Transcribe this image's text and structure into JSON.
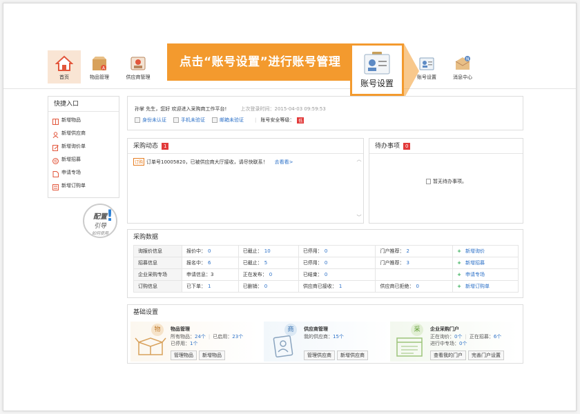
{
  "callout": {
    "text": "点击“账号设置”进行账号管理",
    "box_label": "账号设置",
    "accent": "#f39a2e"
  },
  "nav": {
    "items": [
      {
        "label": "首页",
        "icon": "home-icon",
        "active": true
      },
      {
        "label": "物品管理",
        "icon": "box-icon"
      },
      {
        "label": "供应商管理",
        "icon": "supplier-icon"
      },
      {
        "label": "账号设置",
        "icon": "id-card-icon"
      },
      {
        "label": "消息中心",
        "icon": "message-icon"
      }
    ]
  },
  "sidebar": {
    "title": "快捷入口",
    "items": [
      {
        "label": "新增物品",
        "icon": "grid-icon"
      },
      {
        "label": "新增供应商",
        "icon": "user-icon"
      },
      {
        "label": "新增询价单",
        "icon": "edit-icon"
      },
      {
        "label": "新增招募",
        "icon": "recruit-icon"
      },
      {
        "label": "申请专场",
        "icon": "doc-icon"
      },
      {
        "label": "新增订购单",
        "icon": "order-icon"
      }
    ]
  },
  "guide_badge": {
    "line1": "配置",
    "line2": "引导",
    "line3": "如何使用",
    "mark": "!"
  },
  "welcome": {
    "greeting": "孙掌 先生，您好 欢迎进入采购商工作平台!",
    "last_login_label": "上次登录时间：",
    "last_login": "2015-04-03 09:59:53",
    "verify": [
      "身份未认证",
      "手机未验证",
      "邮箱未验证"
    ],
    "security_label": "账号安全等级：",
    "security_level": "低"
  },
  "activity": {
    "title": "采购动态",
    "count": "1",
    "tag": "订购",
    "message": "订单号10005820，已被供应商大厅接收，请尽快联系！",
    "link": "去看看>"
  },
  "todo": {
    "title": "待办事项",
    "count": "0",
    "empty": "暂无待办事项。"
  },
  "pdata": {
    "title": "采购数据",
    "rows": [
      {
        "cat": "询报价信息",
        "c1l": "报价中：",
        "c1v": "0",
        "c2l": "已截止：",
        "c2v": "10",
        "c3l": "已停用：",
        "c3v": "0",
        "c4l": "门户推荐：",
        "c4v": "2",
        "action": "新增询价"
      },
      {
        "cat": "招募信息",
        "c1l": "报名中：",
        "c1v": "6",
        "c2l": "已截止：",
        "c2v": "5",
        "c3l": "已停用：",
        "c3v": "0",
        "c4l": "门户推荐：",
        "c4v": "3",
        "action": "新增招募"
      },
      {
        "cat": "企业采购专场",
        "c1l": "申请信息：",
        "c1v": "3",
        "c2l": "正在发布：",
        "c2v": "0",
        "c3l": "已结束：",
        "c3v": "0",
        "c4l": "",
        "c4v": "",
        "action": "申请专场"
      },
      {
        "cat": "订购信息",
        "c1l": "已下单：",
        "c1v": "1",
        "c2l": "已删销：",
        "c2v": "0",
        "c3l": "供应商已接收：",
        "c3v": "1",
        "c4l": "供应商已拒绝：",
        "c4v": "0",
        "action": "新增订购单"
      }
    ]
  },
  "basic": {
    "title": "基础设置",
    "cards": [
      {
        "char": "物",
        "title": "物品管理",
        "l1a": "所有物品：",
        "l1av": "24个",
        "l1b": "已启用：",
        "l1bv": "23个",
        "l2a": "已停用：",
        "l2av": "1个",
        "btn1": "管理物品",
        "btn2": "新增物品"
      },
      {
        "char": "商",
        "title": "供应商管理",
        "l1a": "我的供应商：",
        "l1av": "15个",
        "l1b": "",
        "l1bv": "",
        "l2a": "",
        "l2av": "",
        "btn1": "管理供应商",
        "btn2": "新增供应商"
      },
      {
        "char": "采",
        "title": "企业采购门户",
        "l1a": "正在询价：",
        "l1av": "0个",
        "l1b": "正在招募：",
        "l1bv": "6个",
        "l2a": "进行中专场：",
        "l2av": "0个",
        "btn1": "查看我的门户",
        "btn2": "完善门户设置"
      }
    ]
  }
}
